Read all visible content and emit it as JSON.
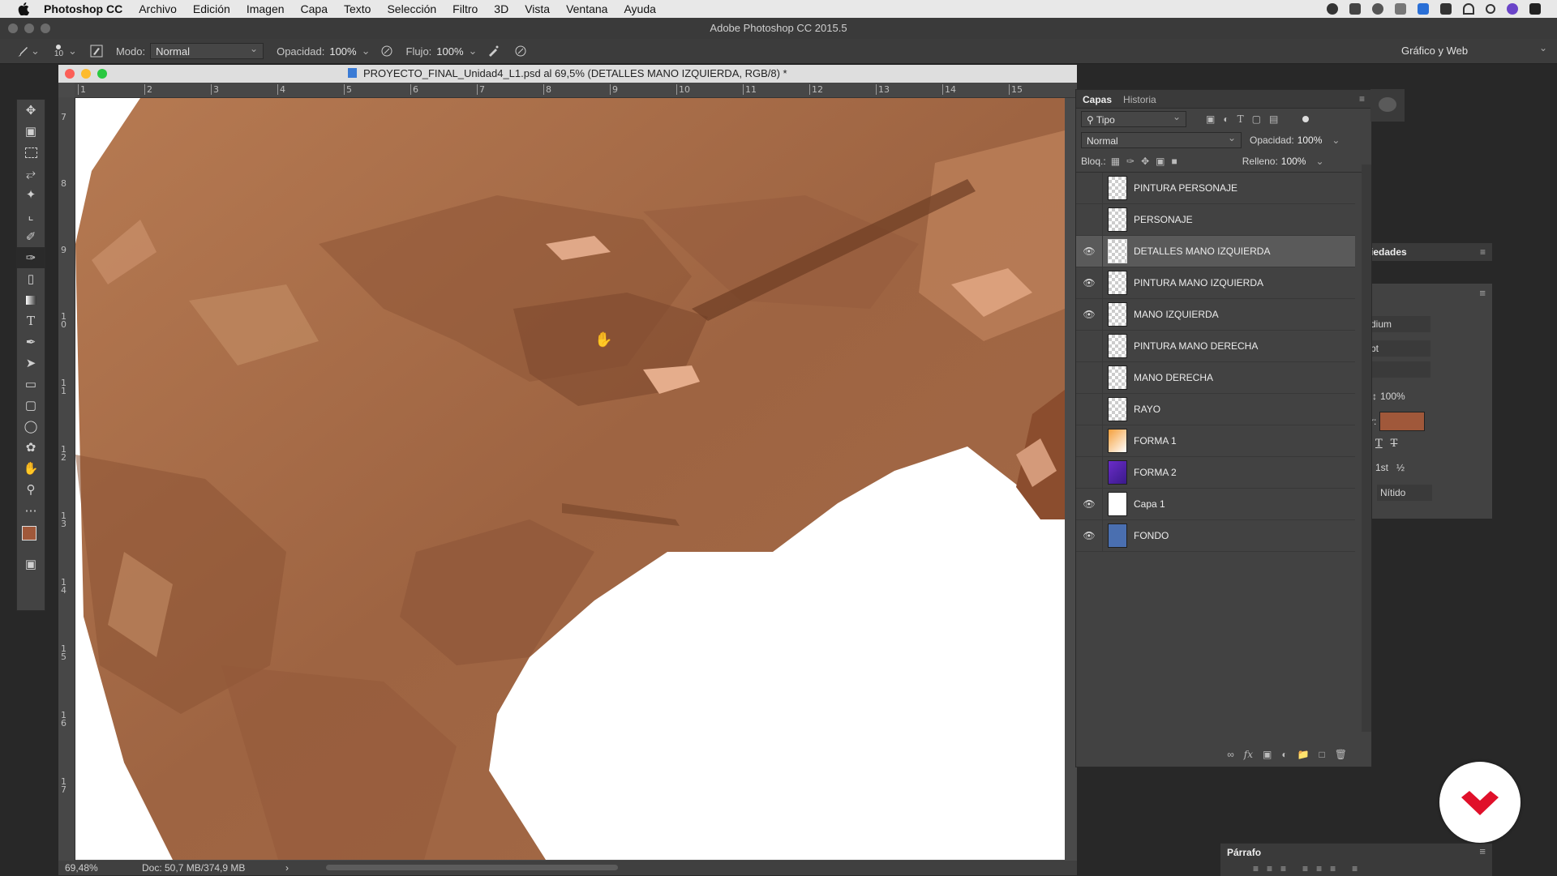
{
  "menubar": {
    "app": "Photoshop CC",
    "items": [
      "Archivo",
      "Edición",
      "Imagen",
      "Capa",
      "Texto",
      "Selección",
      "Filtro",
      "3D",
      "Vista",
      "Ventana",
      "Ayuda"
    ]
  },
  "app_title": "Adobe Photoshop CC 2015.5",
  "options": {
    "brush_size": "10",
    "mode_label": "Modo:",
    "mode_value": "Normal",
    "opacity_label": "Opacidad:",
    "opacity_value": "100%",
    "flow_label": "Flujo:",
    "flow_value": "100%",
    "workspace": "Gráfico y Web"
  },
  "document": {
    "title": "PROYECTO_FINAL_Unidad4_L1.psd al 69,5% (DETALLES MANO IZQUIERDA, RGB/8) *",
    "ruler_top": [
      "1",
      "2",
      "3",
      "4",
      "5",
      "6",
      "7",
      "8",
      "9",
      "10",
      "11",
      "12",
      "13",
      "14",
      "15"
    ],
    "ruler_left": [
      "7",
      "8",
      "9",
      "1\n0",
      "1\n1",
      "1\n2",
      "1\n3",
      "1\n4",
      "1\n5",
      "1\n6",
      "1\n7"
    ],
    "zoom": "69,48%",
    "doc_info": "Doc: 50,7 MB/374,9 MB"
  },
  "layers_panel": {
    "tabs": [
      "Capas",
      "Historia"
    ],
    "filter_value": "Tipo",
    "blend_mode": "Normal",
    "opacity_label": "Opacidad:",
    "opacity_value": "100%",
    "lock_label": "Bloq.:",
    "fill_label": "Relleno:",
    "fill_value": "100%",
    "layers": [
      {
        "name": "PINTURA PERSONAJE",
        "visible": false
      },
      {
        "name": "PERSONAJE",
        "visible": false
      },
      {
        "name": "DETALLES MANO IZQUIERDA",
        "visible": true,
        "selected": true
      },
      {
        "name": "PINTURA MANO IZQUIERDA",
        "visible": true
      },
      {
        "name": "MANO IZQUIERDA",
        "visible": true
      },
      {
        "name": "PINTURA MANO DERECHA",
        "visible": false
      },
      {
        "name": "MANO DERECHA",
        "visible": false
      },
      {
        "name": "RAYO",
        "visible": false
      },
      {
        "name": "FORMA 1",
        "visible": false
      },
      {
        "name": "FORMA 2",
        "visible": false
      },
      {
        "name": "Capa 1",
        "visible": true
      },
      {
        "name": "FONDO",
        "visible": true
      }
    ]
  },
  "properties_panel": {
    "title_fragment": "iedades",
    "font_style_fragment": "dium",
    "size_fragment": "pt",
    "scale_value": "100%",
    "color_fragment": "r:",
    "antialias": "Nítido",
    "superscript": "1st",
    "fraction": "½",
    "color_hex": "#a0583a"
  },
  "paragraph_panel": {
    "title": "Párrafo"
  }
}
